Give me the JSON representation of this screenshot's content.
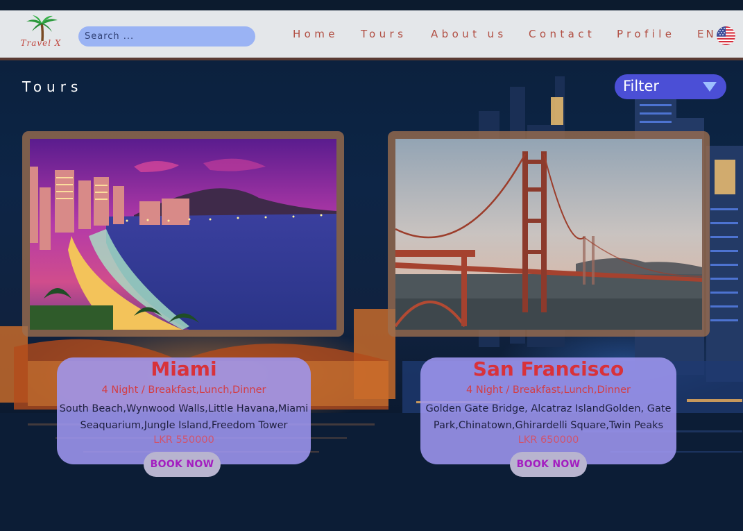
{
  "app": {
    "logo_text": "Travel X"
  },
  "header": {
    "search_placeholder": "Search ...",
    "nav": [
      "Home",
      "Tours",
      "About us",
      "Contact",
      "Profile"
    ],
    "language": "EN",
    "language_flag_icon": "us-flag-icon"
  },
  "page": {
    "title": "Tours",
    "filter_label": "Filter",
    "filter_icon": "triangle-down-icon"
  },
  "tours": [
    {
      "title": "Miami",
      "plan": "4 Night / Breakfast,Lunch,Dinner",
      "places": "South Beach,Wynwood Walls,Little Havana,Miami Seaquarium,Jungle Island,Freedom Tower",
      "price": "LKR 550000",
      "book_label": "BOOK NOW"
    },
    {
      "title": "San Francisco",
      "plan": "4 Night / Breakfast,Lunch,Dinner",
      "places": "Golden Gate Bridge, Alcatraz IslandGolden, Gate Park,Chinatown,Ghirardelli Square,Twin Peaks",
      "price": "LKR 650000",
      "book_label": "BOOK NOW"
    }
  ],
  "colors": {
    "header_bg": "#e4e7ea",
    "nav_text": "#b14e42",
    "search_bg": "#9ab3f4",
    "filter_bg": "#4b4fd6",
    "card_info_bg": "#9e96f0",
    "card_title": "#d8323a",
    "book_text": "#a31ec0"
  }
}
